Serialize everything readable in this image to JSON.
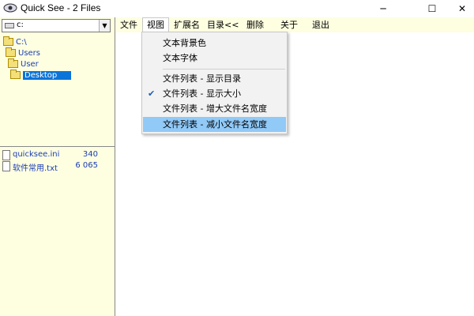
{
  "window": {
    "title": "Quick See - 2 Files",
    "icon": "eye-icon",
    "controls": {
      "minimize": "─",
      "maximize": "☐",
      "close": "✕"
    }
  },
  "drive": {
    "value": "c:",
    "icon": "drive-icon"
  },
  "tree": [
    {
      "label": "C:\\",
      "selected": false
    },
    {
      "label": "Users",
      "selected": false
    },
    {
      "label": "User",
      "selected": false
    },
    {
      "label": "Desktop",
      "selected": true
    }
  ],
  "files": [
    {
      "name": "quicksee.ini",
      "size": "340"
    },
    {
      "name": "软件常用.txt",
      "size": "6 065"
    }
  ],
  "menu": [
    {
      "label": "文件",
      "active": false
    },
    {
      "label": "视图",
      "active": true
    },
    {
      "label": "扩展名",
      "active": false
    },
    {
      "label": "目录<<",
      "active": false
    },
    {
      "label": "删除",
      "active": false
    },
    {
      "label": "关于",
      "active": false
    },
    {
      "label": "退出",
      "active": false
    }
  ],
  "view_menu": {
    "items": [
      {
        "label": "文本背景色",
        "checked": false,
        "hover": false
      },
      {
        "label": "文本字体",
        "checked": false,
        "hover": false
      },
      {
        "label": "文件列表 - 显示目录",
        "checked": false,
        "hover": false
      },
      {
        "label": "文件列表 - 显示大小",
        "checked": true,
        "hover": false
      },
      {
        "label": "文件列表 - 增大文件名宽度",
        "checked": false,
        "hover": false
      },
      {
        "label": "文件列表 - 减小文件名宽度",
        "checked": false,
        "hover": true
      }
    ],
    "check_glyph": "✔"
  },
  "colors": {
    "panel_bg": "#fefee1",
    "link": "#1a3db5",
    "selection": "#0a74d9",
    "menu_hover": "#91c9f7"
  }
}
